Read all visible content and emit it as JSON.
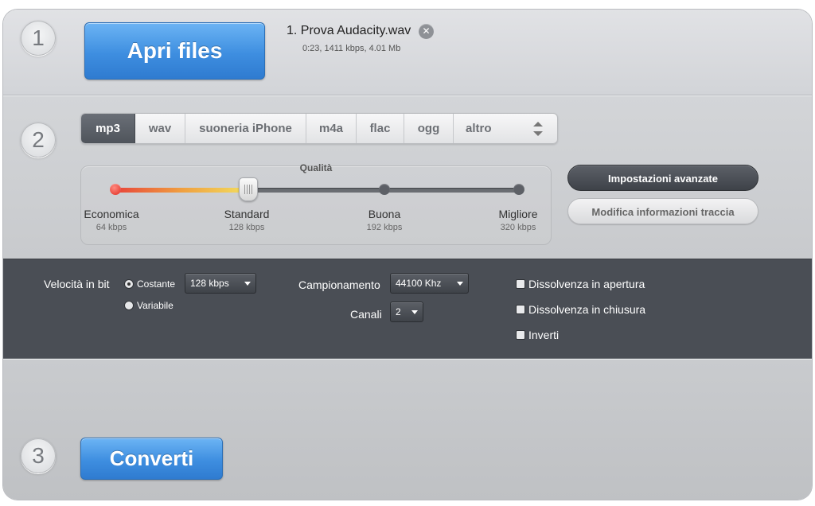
{
  "steps": {
    "one": "1",
    "two": "2",
    "three": "3"
  },
  "open_files_label": "Apri files",
  "file": {
    "name": "1. Prova Audacity.wav",
    "meta": "0:23, 1411 kbps, 4.01 Mb",
    "remove_icon": "close-x"
  },
  "format_tabs": [
    "mp3",
    "wav",
    "suoneria iPhone",
    "m4a",
    "flac",
    "ogg",
    "altro"
  ],
  "active_format": "mp3",
  "quality": {
    "title": "Qualità",
    "selected_level": "Standard",
    "levels": [
      {
        "label": "Economica",
        "sub": "64 kbps"
      },
      {
        "label": "Standard",
        "sub": "128 kbps"
      },
      {
        "label": "Buona",
        "sub": "192 kbps"
      },
      {
        "label": "Migliore",
        "sub": "320 kbps"
      }
    ]
  },
  "buttons": {
    "advanced": "Impostazioni avanzate",
    "edit_track": "Modifica informazioni traccia",
    "convert": "Converti"
  },
  "advanced": {
    "bitrate_label": "Velocità in bit",
    "constant_label": "Costante",
    "variable_label": "Variabile",
    "bitrate_mode": "Costante",
    "bitrate_value": "128 kbps",
    "sampling_label": "Campionamento",
    "sampling_value": "44100 Khz",
    "channels_label": "Canali",
    "channels_value": "2",
    "fade_in": "Dissolvenza in apertura",
    "fade_out": "Dissolvenza in chiusura",
    "invert": "Inverti"
  },
  "colors": {
    "accent_blue": "#3e8ee0",
    "dark_panel": "#4a4e55"
  }
}
